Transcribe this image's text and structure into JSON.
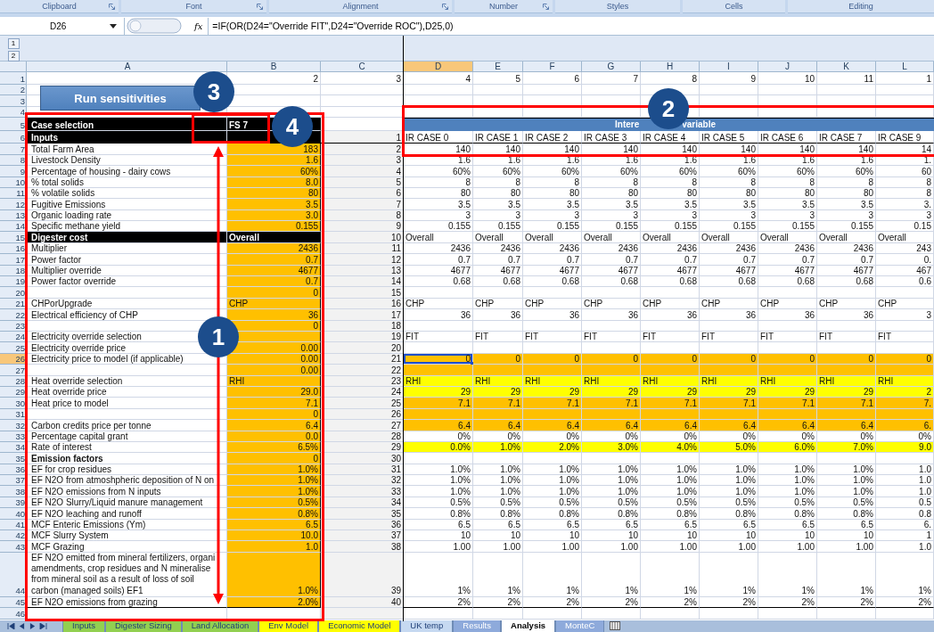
{
  "ribbon_groups": [
    {
      "label": "Clipboard",
      "launcher": true
    },
    {
      "label": "Font",
      "launcher": true
    },
    {
      "label": "Alignment",
      "launcher": true
    },
    {
      "label": "Number",
      "launcher": true
    },
    {
      "label": "Styles",
      "launcher": false
    },
    {
      "label": "Cells",
      "launcher": false
    },
    {
      "label": "Editing",
      "launcher": false
    }
  ],
  "formula_bar": {
    "name_box": "D26",
    "function_label": "fx",
    "formula": "=IF(OR(D24=\"Override FIT\",D24=\"Override ROC\"),D25,0)"
  },
  "outline_levels": [
    "1",
    "2"
  ],
  "columns": [
    {
      "label": "A",
      "selected": false
    },
    {
      "label": "B",
      "selected": false
    },
    {
      "label": "C",
      "selected": false
    },
    {
      "label": "D",
      "selected": true
    },
    {
      "label": "E",
      "selected": false
    },
    {
      "label": "F",
      "selected": false
    },
    {
      "label": "G",
      "selected": false
    },
    {
      "label": "H",
      "selected": false
    },
    {
      "label": "I",
      "selected": false
    },
    {
      "label": "J",
      "selected": false
    },
    {
      "label": "K",
      "selected": false
    },
    {
      "label": "L",
      "selected": false
    }
  ],
  "run_button": "Run sensitivities",
  "rows": [
    {
      "number": "1",
      "selected": false,
      "kind": "plain",
      "input": false,
      "value": "2",
      "ref": "3",
      "cases": [
        "4",
        "5",
        "6",
        "7",
        "8",
        "9",
        "10",
        "11",
        "1"
      ]
    },
    {
      "number": "2",
      "selected": false,
      "kind": "plain",
      "input": false
    },
    {
      "number": "3",
      "selected": false,
      "kind": "plain",
      "input": false
    },
    {
      "number": "4",
      "selected": false,
      "kind": "plain",
      "input": false
    },
    {
      "number": "5",
      "selected": false,
      "kind": "section",
      "label": "Case selection",
      "value": "FS 7",
      "case_header": [
        "Intere",
        "variable"
      ]
    },
    {
      "number": "6",
      "selected": false,
      "kind": "section",
      "label": "Inputs",
      "ref": "1",
      "cases": [
        "IR CASE 0",
        "IR CASE 1",
        "IR CASE 2",
        "IR CASE 3",
        "IR CASE 4",
        "IR CASE 5",
        "IR CASE 6",
        "IR CASE 7",
        "IR CASE 9"
      ]
    },
    {
      "number": "7",
      "selected": false,
      "kind": "plain",
      "input": true,
      "label": "Total Farm Area",
      "value": "183",
      "ref": "2",
      "cases": [
        "140",
        "140",
        "140",
        "140",
        "140",
        "140",
        "140",
        "140",
        "14"
      ]
    },
    {
      "number": "8",
      "selected": false,
      "kind": "plain",
      "input": true,
      "label": "Livestock Density",
      "value": "1.6",
      "ref": "3",
      "cases": [
        "1.6",
        "1.6",
        "1.6",
        "1.6",
        "1.6",
        "1.6",
        "1.6",
        "1.6",
        "1."
      ]
    },
    {
      "number": "9",
      "selected": false,
      "kind": "plain",
      "input": true,
      "label": "Percentage of housing - dairy cows",
      "value": "60%",
      "ref": "4",
      "cases": [
        "60%",
        "60%",
        "60%",
        "60%",
        "60%",
        "60%",
        "60%",
        "60%",
        "60"
      ]
    },
    {
      "number": "10",
      "selected": false,
      "kind": "plain",
      "input": true,
      "label": "% total solids",
      "value": "8.0",
      "ref": "5",
      "cases": [
        "8",
        "8",
        "8",
        "8",
        "8",
        "8",
        "8",
        "8",
        "8"
      ]
    },
    {
      "number": "11",
      "selected": false,
      "kind": "plain",
      "input": true,
      "label": "% volatile solids",
      "value": "80",
      "ref": "6",
      "cases": [
        "80",
        "80",
        "80",
        "80",
        "80",
        "80",
        "80",
        "80",
        "8"
      ]
    },
    {
      "number": "12",
      "selected": false,
      "kind": "plain",
      "input": true,
      "label": "Fugitive Emissions",
      "value": "3.5",
      "ref": "7",
      "cases": [
        "3.5",
        "3.5",
        "3.5",
        "3.5",
        "3.5",
        "3.5",
        "3.5",
        "3.5",
        "3."
      ]
    },
    {
      "number": "13",
      "selected": false,
      "kind": "plain",
      "input": true,
      "label": "Organic loading rate",
      "value": "3.0",
      "ref": "8",
      "cases": [
        "3",
        "3",
        "3",
        "3",
        "3",
        "3",
        "3",
        "3",
        "3"
      ]
    },
    {
      "number": "14",
      "selected": false,
      "kind": "plain",
      "input": true,
      "label": "Specific methane yield",
      "value": "0.155",
      "ref": "9",
      "cases": [
        "0.155",
        "0.155",
        "0.155",
        "0.155",
        "0.155",
        "0.155",
        "0.155",
        "0.155",
        "0.15"
      ]
    },
    {
      "number": "15",
      "selected": false,
      "kind": "section",
      "label": "Digester cost",
      "value": "Overall",
      "ref": "10",
      "cases": [
        "Overall",
        "Overall",
        "Overall",
        "Overall",
        "Overall",
        "Overall",
        "Overall",
        "Overall",
        "Overall"
      ]
    },
    {
      "number": "16",
      "selected": false,
      "kind": "plain",
      "input": true,
      "label": "Multiplier",
      "value": "2436",
      "ref": "11",
      "cases": [
        "2436",
        "2436",
        "2436",
        "2436",
        "2436",
        "2436",
        "2436",
        "2436",
        "243"
      ]
    },
    {
      "number": "17",
      "selected": false,
      "kind": "plain",
      "input": true,
      "label": "Power factor",
      "value": "0.7",
      "ref": "12",
      "cases": [
        "0.7",
        "0.7",
        "0.7",
        "0.7",
        "0.7",
        "0.7",
        "0.7",
        "0.7",
        "0."
      ]
    },
    {
      "number": "18",
      "selected": false,
      "kind": "plain",
      "input": true,
      "label": "Multiplier override",
      "value": "4677",
      "ref": "13",
      "cases": [
        "4677",
        "4677",
        "4677",
        "4677",
        "4677",
        "4677",
        "4677",
        "4677",
        "467"
      ]
    },
    {
      "number": "19",
      "selected": false,
      "kind": "plain",
      "input": true,
      "label": "Power factor override",
      "value": "0.7",
      "ref": "14",
      "cases": [
        "0.68",
        "0.68",
        "0.68",
        "0.68",
        "0.68",
        "0.68",
        "0.68",
        "0.68",
        "0.6"
      ]
    },
    {
      "number": "20",
      "selected": false,
      "kind": "plain",
      "input": true,
      "value": "0",
      "ref": "15"
    },
    {
      "number": "21",
      "selected": false,
      "kind": "plain",
      "input": true,
      "label": "CHPorUpgrade",
      "value": "CHP",
      "ref": "16",
      "cases": [
        "CHP",
        "CHP",
        "CHP",
        "CHP",
        "CHP",
        "CHP",
        "CHP",
        "CHP",
        "CHP"
      ]
    },
    {
      "number": "22",
      "selected": false,
      "kind": "plain",
      "input": true,
      "label": "Electrical efficiency of CHP",
      "value": "36",
      "ref": "17",
      "cases": [
        "36",
        "36",
        "36",
        "36",
        "36",
        "36",
        "36",
        "36",
        "3"
      ]
    },
    {
      "number": "23",
      "selected": false,
      "kind": "plain",
      "input": true,
      "value": "0",
      "ref": "18"
    },
    {
      "number": "24",
      "selected": false,
      "kind": "plain",
      "input": true,
      "label": "Electricity override selection",
      "ref": "19",
      "cases": [
        "FIT",
        "FIT",
        "FIT",
        "FIT",
        "FIT",
        "FIT",
        "FIT",
        "FIT",
        "FIT"
      ]
    },
    {
      "number": "25",
      "selected": false,
      "kind": "plain",
      "input": true,
      "label": "Electricity override price",
      "value": "0.00",
      "ref": "20"
    },
    {
      "number": "26",
      "selected": true,
      "kind": "plain",
      "input": true,
      "color": "#ffc000",
      "label": "Electricity price to model (if applicable)",
      "value": "0.00",
      "ref": "21",
      "cases": [
        "0",
        "0",
        "0",
        "0",
        "0",
        "0",
        "0",
        "0",
        "0"
      ]
    },
    {
      "number": "27",
      "selected": false,
      "kind": "plain",
      "input": true,
      "color": "#ffc000",
      "value": "0.00",
      "ref": "22"
    },
    {
      "number": "28",
      "selected": false,
      "kind": "plain",
      "input": true,
      "color": "#ffff00",
      "label": "Heat override selection",
      "value": "RHI",
      "ref": "23",
      "cases": [
        "RHI",
        "RHI",
        "RHI",
        "RHI",
        "RHI",
        "RHI",
        "RHI",
        "RHI",
        "RHI"
      ]
    },
    {
      "number": "29",
      "selected": false,
      "kind": "plain",
      "input": true,
      "color": "#ffff00",
      "label": "Heat override price",
      "value": "29.0",
      "ref": "24",
      "cases": [
        "29",
        "29",
        "29",
        "29",
        "29",
        "29",
        "29",
        "29",
        "2"
      ]
    },
    {
      "number": "30",
      "selected": false,
      "kind": "plain",
      "input": true,
      "color": "#ffc000",
      "label": "Heat price to model",
      "value": "7.1",
      "ref": "25",
      "cases": [
        "7.1",
        "7.1",
        "7.1",
        "7.1",
        "7.1",
        "7.1",
        "7.1",
        "7.1",
        "7."
      ]
    },
    {
      "number": "31",
      "selected": false,
      "kind": "plain",
      "input": true,
      "color": "#ffc000",
      "value": "0",
      "ref": "26"
    },
    {
      "number": "32",
      "selected": false,
      "kind": "plain",
      "input": true,
      "color": "#ffc000",
      "label": "Carbon credits price per tonne",
      "value": "6.4",
      "ref": "27",
      "cases": [
        "6.4",
        "6.4",
        "6.4",
        "6.4",
        "6.4",
        "6.4",
        "6.4",
        "6.4",
        "6."
      ]
    },
    {
      "number": "33",
      "selected": false,
      "kind": "plain",
      "input": true,
      "label": "Percentage capital grant",
      "value": "0.0",
      "ref": "28",
      "cases": [
        "0%",
        "0%",
        "0%",
        "0%",
        "0%",
        "0%",
        "0%",
        "0%",
        "0%"
      ]
    },
    {
      "number": "34",
      "selected": false,
      "kind": "plain",
      "input": true,
      "color": "#ffff00",
      "label": "Rate of interest",
      "value": "6.5%",
      "ref": "29",
      "cases": [
        "0.0%",
        "1.0%",
        "2.0%",
        "3.0%",
        "4.0%",
        "5.0%",
        "6.0%",
        "7.0%",
        "9.0"
      ]
    },
    {
      "number": "35",
      "selected": false,
      "kind": "heading",
      "input": true,
      "label": "Emission factors",
      "value": "0",
      "ref": "30"
    },
    {
      "number": "36",
      "selected": false,
      "kind": "plain",
      "input": true,
      "label": "EF for crop residues",
      "value": "1.0%",
      "ref": "31",
      "cases": [
        "1.0%",
        "1.0%",
        "1.0%",
        "1.0%",
        "1.0%",
        "1.0%",
        "1.0%",
        "1.0%",
        "1.0"
      ]
    },
    {
      "number": "37",
      "selected": false,
      "kind": "plain",
      "input": true,
      "label": "EF N2O from atmoshpheric deposition of N on",
      "value": "1.0%",
      "ref": "32",
      "cases": [
        "1.0%",
        "1.0%",
        "1.0%",
        "1.0%",
        "1.0%",
        "1.0%",
        "1.0%",
        "1.0%",
        "1.0"
      ]
    },
    {
      "number": "38",
      "selected": false,
      "kind": "plain",
      "input": true,
      "label": "EF N2O emissions from N inputs",
      "value": "1.0%",
      "ref": "33",
      "cases": [
        "1.0%",
        "1.0%",
        "1.0%",
        "1.0%",
        "1.0%",
        "1.0%",
        "1.0%",
        "1.0%",
        "1.0"
      ]
    },
    {
      "number": "39",
      "selected": false,
      "kind": "plain",
      "input": true,
      "label": "EF N2O Slurry/Liquid manure management",
      "value": "0.5%",
      "ref": "34",
      "cases": [
        "0.5%",
        "0.5%",
        "0.5%",
        "0.5%",
        "0.5%",
        "0.5%",
        "0.5%",
        "0.5%",
        "0.5"
      ]
    },
    {
      "number": "40",
      "selected": false,
      "kind": "plain",
      "input": true,
      "label": "EF N2O leaching and runoff",
      "value": "0.8%",
      "ref": "35",
      "cases": [
        "0.8%",
        "0.8%",
        "0.8%",
        "0.8%",
        "0.8%",
        "0.8%",
        "0.8%",
        "0.8%",
        "0.8"
      ]
    },
    {
      "number": "41",
      "selected": false,
      "kind": "plain",
      "input": true,
      "label": "MCF Enteric Emissions (Ym)",
      "value": "6.5",
      "ref": "36",
      "cases": [
        "6.5",
        "6.5",
        "6.5",
        "6.5",
        "6.5",
        "6.5",
        "6.5",
        "6.5",
        "6."
      ]
    },
    {
      "number": "42",
      "selected": false,
      "kind": "plain",
      "input": true,
      "label": "MCF Slurry System",
      "value": "10.0",
      "ref": "37",
      "cases": [
        "10",
        "10",
        "10",
        "10",
        "10",
        "10",
        "10",
        "10",
        "1"
      ]
    },
    {
      "number": "43",
      "selected": false,
      "kind": "plain",
      "input": true,
      "label": "MCF Grazing",
      "value": "1.0",
      "ref": "38",
      "cases": [
        "1.00",
        "1.00",
        "1.00",
        "1.00",
        "1.00",
        "1.00",
        "1.00",
        "1.00",
        "1.0"
      ]
    },
    {
      "number": "44",
      "selected": false,
      "kind": "plain",
      "input": true,
      "label": "EF N2O emitted from mineral fertilizers, organi\namendments, crop residues and N mineralise\nfrom mineral soil as a result of loss of soil\ncarbon (managed soils) EF1",
      "value": "1.0%",
      "ref": "39",
      "cases": [
        "1%",
        "1%",
        "1%",
        "1%",
        "1%",
        "1%",
        "1%",
        "1%",
        "1%"
      ]
    },
    {
      "number": "45",
      "selected": false,
      "kind": "plain",
      "input": true,
      "label": "EF N2O emissions from grazing",
      "value": "2.0%",
      "ref": "40",
      "cases": [
        "2%",
        "2%",
        "2%",
        "2%",
        "2%",
        "2%",
        "2%",
        "2%",
        "2%"
      ]
    },
    {
      "number": "46",
      "selected": false,
      "kind": "plain",
      "input": false
    }
  ],
  "callouts": [
    "1",
    "2",
    "3",
    "4"
  ],
  "sheet_tabs": [
    {
      "label": "Inputs",
      "color": "#92d050",
      "selected": false
    },
    {
      "label": "Digester Sizing",
      "color": "#92d050",
      "selected": false
    },
    {
      "label": "Land Allocation",
      "color": "#92d050",
      "selected": false
    },
    {
      "label": "Env Model",
      "color": "#ffff00",
      "selected": false
    },
    {
      "label": "Economic Model",
      "color": "#ffff00",
      "selected": false
    },
    {
      "label": "UK temp",
      "color": "#c6d9f1",
      "selected": false
    },
    {
      "label": "Results",
      "color": "#8eaadb",
      "selected": false
    },
    {
      "label": "Analysis",
      "color": "#ffffff",
      "selected": true
    },
    {
      "label": "MonteC",
      "color": "#8eaadb",
      "selected": false
    }
  ]
}
